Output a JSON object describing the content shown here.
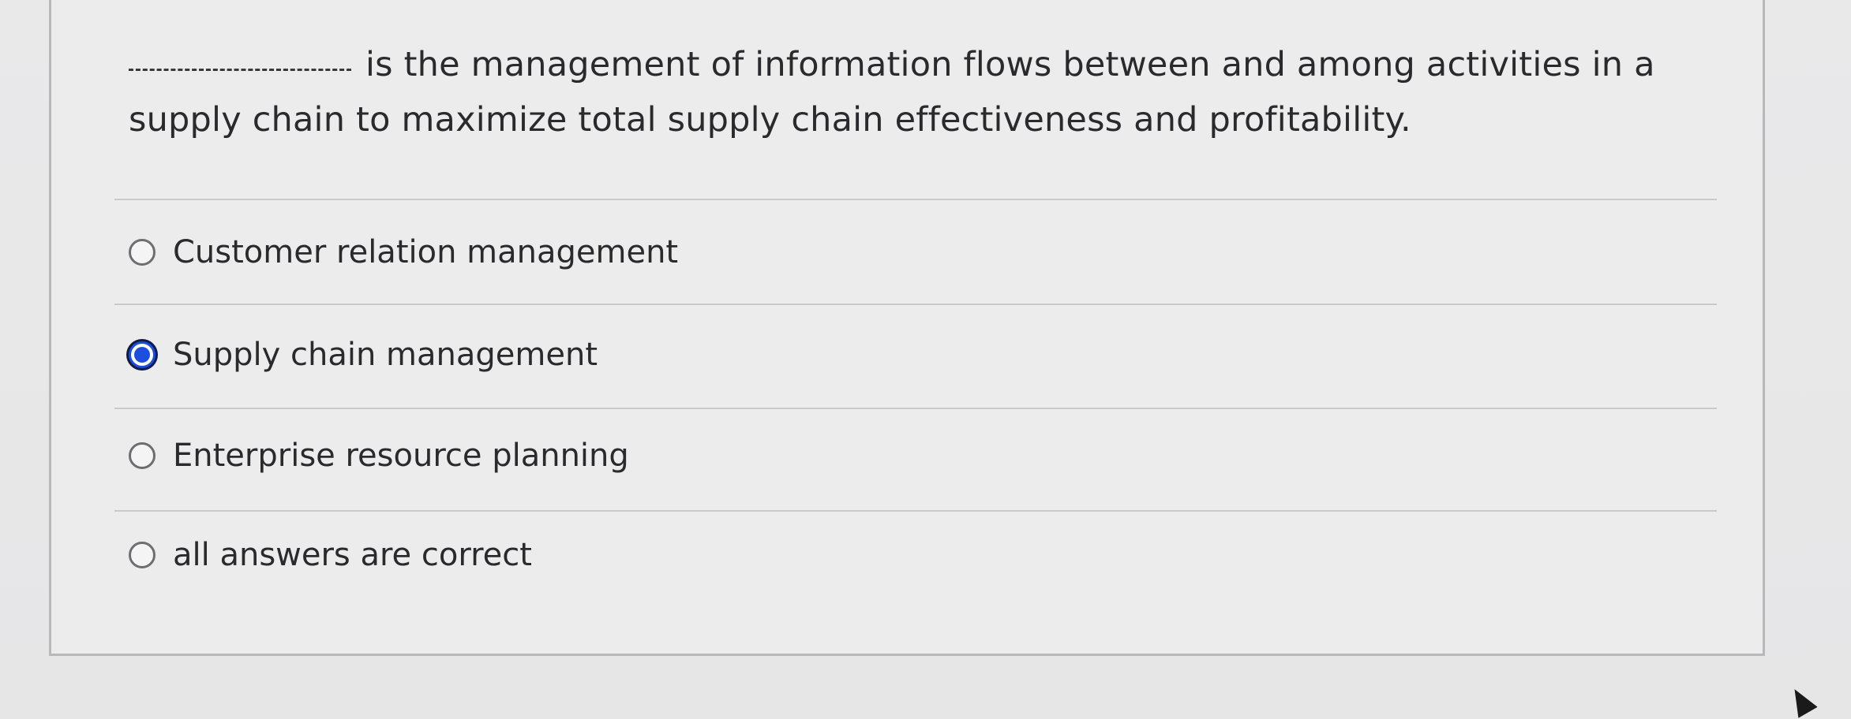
{
  "question": {
    "text": "is the management of information flows between and among activities in a supply chain to maximize total supply chain effectiveness and profitability."
  },
  "options": [
    {
      "label": "Customer relation management",
      "selected": false
    },
    {
      "label": "Supply chain management",
      "selected": true
    },
    {
      "label": "Enterprise resource planning",
      "selected": false
    },
    {
      "label": "all answers are correct",
      "selected": false
    }
  ],
  "colors": {
    "accent": "#1d4fdf",
    "background": "#e9e9ea",
    "text": "#2a2a2c"
  }
}
